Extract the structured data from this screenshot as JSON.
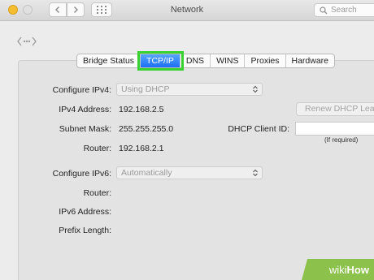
{
  "window": {
    "title": "Network"
  },
  "search": {
    "placeholder": "Search"
  },
  "tabs": [
    {
      "label": "Bridge Status",
      "active": false
    },
    {
      "label": "TCP/IP",
      "active": true
    },
    {
      "label": "DNS",
      "active": false
    },
    {
      "label": "WINS",
      "active": false
    },
    {
      "label": "Proxies",
      "active": false
    },
    {
      "label": "Hardware",
      "active": false
    }
  ],
  "ipv4": {
    "configure_label": "Configure IPv4:",
    "configure_value": "Using DHCP",
    "address_label": "IPv4 Address:",
    "address_value": "192.168.2.5",
    "subnet_label": "Subnet Mask:",
    "subnet_value": "255.255.255.0",
    "router_label": "Router:",
    "router_value": "192.168.2.1",
    "renew_button": "Renew DHCP Lease",
    "client_id_label": "DHCP Client ID:",
    "client_id_value": "",
    "client_id_hint": "(If required)"
  },
  "ipv6": {
    "configure_label": "Configure IPv6:",
    "configure_value": "Automatically",
    "router_label": "Router:",
    "address_label": "IPv6 Address:",
    "prefix_label": "Prefix Length:"
  },
  "watermark": {
    "part1": "wiki",
    "part2": "How"
  },
  "colors": {
    "active_tab": "#1d6ef5",
    "highlight": "#37d22f",
    "watermark_bg": "#8cc14b"
  }
}
